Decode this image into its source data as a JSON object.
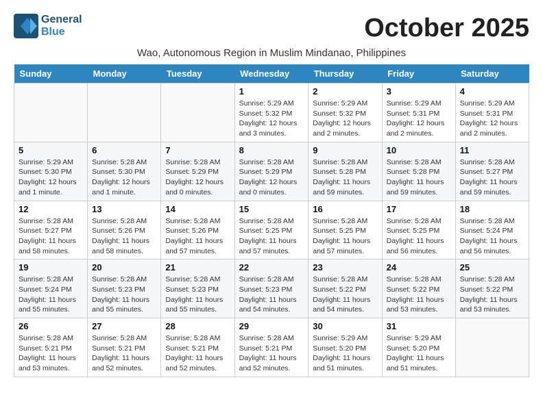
{
  "header": {
    "logo_line1": "General",
    "logo_line2": "Blue",
    "month_title": "October 2025",
    "subtitle": "Wao, Autonomous Region in Muslim Mindanao, Philippines"
  },
  "weekdays": [
    "Sunday",
    "Monday",
    "Tuesday",
    "Wednesday",
    "Thursday",
    "Friday",
    "Saturday"
  ],
  "weeks": [
    [
      {
        "day": "",
        "info": ""
      },
      {
        "day": "",
        "info": ""
      },
      {
        "day": "",
        "info": ""
      },
      {
        "day": "1",
        "info": "Sunrise: 5:29 AM\nSunset: 5:32 PM\nDaylight: 12 hours\nand 3 minutes."
      },
      {
        "day": "2",
        "info": "Sunrise: 5:29 AM\nSunset: 5:32 PM\nDaylight: 12 hours\nand 2 minutes."
      },
      {
        "day": "3",
        "info": "Sunrise: 5:29 AM\nSunset: 5:31 PM\nDaylight: 12 hours\nand 2 minutes."
      },
      {
        "day": "4",
        "info": "Sunrise: 5:29 AM\nSunset: 5:31 PM\nDaylight: 12 hours\nand 2 minutes."
      }
    ],
    [
      {
        "day": "5",
        "info": "Sunrise: 5:29 AM\nSunset: 5:30 PM\nDaylight: 12 hours\nand 1 minute."
      },
      {
        "day": "6",
        "info": "Sunrise: 5:28 AM\nSunset: 5:30 PM\nDaylight: 12 hours\nand 1 minute."
      },
      {
        "day": "7",
        "info": "Sunrise: 5:28 AM\nSunset: 5:29 PM\nDaylight: 12 hours\nand 0 minutes."
      },
      {
        "day": "8",
        "info": "Sunrise: 5:28 AM\nSunset: 5:29 PM\nDaylight: 12 hours\nand 0 minutes."
      },
      {
        "day": "9",
        "info": "Sunrise: 5:28 AM\nSunset: 5:28 PM\nDaylight: 11 hours\nand 59 minutes."
      },
      {
        "day": "10",
        "info": "Sunrise: 5:28 AM\nSunset: 5:28 PM\nDaylight: 11 hours\nand 59 minutes."
      },
      {
        "day": "11",
        "info": "Sunrise: 5:28 AM\nSunset: 5:27 PM\nDaylight: 11 hours\nand 59 minutes."
      }
    ],
    [
      {
        "day": "12",
        "info": "Sunrise: 5:28 AM\nSunset: 5:27 PM\nDaylight: 11 hours\nand 58 minutes."
      },
      {
        "day": "13",
        "info": "Sunrise: 5:28 AM\nSunset: 5:26 PM\nDaylight: 11 hours\nand 58 minutes."
      },
      {
        "day": "14",
        "info": "Sunrise: 5:28 AM\nSunset: 5:26 PM\nDaylight: 11 hours\nand 57 minutes."
      },
      {
        "day": "15",
        "info": "Sunrise: 5:28 AM\nSunset: 5:25 PM\nDaylight: 11 hours\nand 57 minutes."
      },
      {
        "day": "16",
        "info": "Sunrise: 5:28 AM\nSunset: 5:25 PM\nDaylight: 11 hours\nand 57 minutes."
      },
      {
        "day": "17",
        "info": "Sunrise: 5:28 AM\nSunset: 5:25 PM\nDaylight: 11 hours\nand 56 minutes."
      },
      {
        "day": "18",
        "info": "Sunrise: 5:28 AM\nSunset: 5:24 PM\nDaylight: 11 hours\nand 56 minutes."
      }
    ],
    [
      {
        "day": "19",
        "info": "Sunrise: 5:28 AM\nSunset: 5:24 PM\nDaylight: 11 hours\nand 55 minutes."
      },
      {
        "day": "20",
        "info": "Sunrise: 5:28 AM\nSunset: 5:23 PM\nDaylight: 11 hours\nand 55 minutes."
      },
      {
        "day": "21",
        "info": "Sunrise: 5:28 AM\nSunset: 5:23 PM\nDaylight: 11 hours\nand 55 minutes."
      },
      {
        "day": "22",
        "info": "Sunrise: 5:28 AM\nSunset: 5:23 PM\nDaylight: 11 hours\nand 54 minutes."
      },
      {
        "day": "23",
        "info": "Sunrise: 5:28 AM\nSunset: 5:22 PM\nDaylight: 11 hours\nand 54 minutes."
      },
      {
        "day": "24",
        "info": "Sunrise: 5:28 AM\nSunset: 5:22 PM\nDaylight: 11 hours\nand 53 minutes."
      },
      {
        "day": "25",
        "info": "Sunrise: 5:28 AM\nSunset: 5:22 PM\nDaylight: 11 hours\nand 53 minutes."
      }
    ],
    [
      {
        "day": "26",
        "info": "Sunrise: 5:28 AM\nSunset: 5:21 PM\nDaylight: 11 hours\nand 53 minutes."
      },
      {
        "day": "27",
        "info": "Sunrise: 5:28 AM\nSunset: 5:21 PM\nDaylight: 11 hours\nand 52 minutes."
      },
      {
        "day": "28",
        "info": "Sunrise: 5:28 AM\nSunset: 5:21 PM\nDaylight: 11 hours\nand 52 minutes."
      },
      {
        "day": "29",
        "info": "Sunrise: 5:28 AM\nSunset: 5:21 PM\nDaylight: 11 hours\nand 52 minutes."
      },
      {
        "day": "30",
        "info": "Sunrise: 5:29 AM\nSunset: 5:20 PM\nDaylight: 11 hours\nand 51 minutes."
      },
      {
        "day": "31",
        "info": "Sunrise: 5:29 AM\nSunset: 5:20 PM\nDaylight: 11 hours\nand 51 minutes."
      },
      {
        "day": "",
        "info": ""
      }
    ]
  ]
}
